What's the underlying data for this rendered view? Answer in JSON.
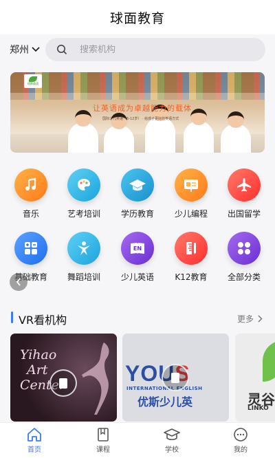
{
  "header": {
    "title": "球面教育"
  },
  "search": {
    "city": "郑州",
    "placeholder": "搜索机构"
  },
  "banner": {
    "slogan": "让英语成为卓越能力的载体",
    "subtitle": "国际少儿英语（6-12岁）  · 给孩子更好的英语方式",
    "logo_text": "优斯英语"
  },
  "categories": [
    {
      "label": "音乐",
      "icon": "music-note-icon",
      "color": "#ff8a2a"
    },
    {
      "label": "艺考培训",
      "icon": "palette-icon",
      "color": "#2bb6e6"
    },
    {
      "label": "学历教育",
      "icon": "graduation-cap-icon",
      "color": "#1fa8d8"
    },
    {
      "label": "少儿编程",
      "icon": "coding-board-icon",
      "color": "#ff8a2a"
    },
    {
      "label": "出国留学",
      "icon": "airplane-icon",
      "color": "#ff4545"
    },
    {
      "label": "基础教育",
      "icon": "calculator-icon",
      "color": "#2f7ff5"
    },
    {
      "label": "舞蹈培训",
      "icon": "dancer-icon",
      "color": "#2bb6e6"
    },
    {
      "label": "少儿英语",
      "icon": "en-book-icon",
      "color": "#8a3fd8"
    },
    {
      "label": "K12教育",
      "icon": "ruler-pencil-icon",
      "color": "#ff4a4a"
    },
    {
      "label": "全部分类",
      "icon": "grid-icon",
      "color": "#8a3fd8"
    }
  ],
  "vr_section": {
    "title": "VR看机构",
    "more": "更多"
  },
  "vr_cards": [
    {
      "name": "Yihao Art Center",
      "script_lines": [
        "Yihao",
        "Art",
        "Center"
      ]
    },
    {
      "name": "优斯少儿英语",
      "brand": "YOUS",
      "tag": "INTERNATIONAL ENGLISH",
      "cn": "优斯少儿英"
    },
    {
      "name": "灵谷",
      "cn": "灵谷",
      "en": "LINKO"
    }
  ],
  "tabbar": [
    {
      "label": "首页",
      "icon": "home-icon",
      "active": true
    },
    {
      "label": "课程",
      "icon": "book-icon",
      "active": false
    },
    {
      "label": "学校",
      "icon": "school-cap-icon",
      "active": false
    },
    {
      "label": "我的",
      "icon": "profile-icon",
      "active": false
    }
  ],
  "colors": {
    "accent": "#3b7bf6"
  }
}
